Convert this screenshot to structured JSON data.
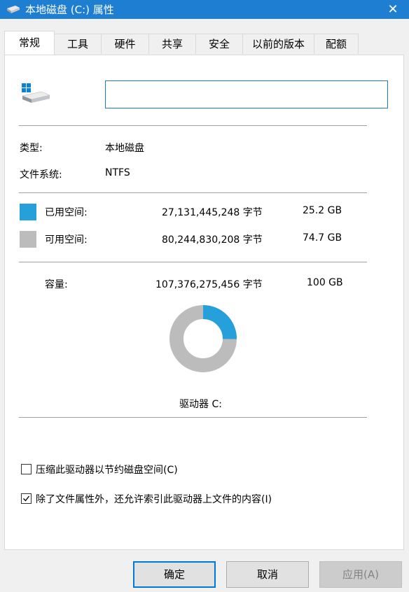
{
  "window": {
    "title": "本地磁盘 (C:) 属性",
    "close": "✕"
  },
  "tabs": [
    "常规",
    "工具",
    "硬件",
    "共享",
    "安全",
    "以前的版本",
    "配额"
  ],
  "active_tab": "常规",
  "drive": {
    "name_value": ""
  },
  "info": {
    "type_label": "类型:",
    "type_value": "本地磁盘",
    "fs_label": "文件系统:",
    "fs_value": "NTFS"
  },
  "space": {
    "used": {
      "label": "已用空间:",
      "bytes": "27,131,445,248 字节",
      "size": "25.2 GB",
      "color": "#26a0da"
    },
    "free": {
      "label": "可用空间:",
      "bytes": "80,244,830,208 字节",
      "size": "74.7 GB",
      "color": "#bcbcbc"
    },
    "capacity": {
      "label": "容量:",
      "bytes": "107,376,275,456 字节",
      "size": "100 GB"
    },
    "used_fraction": 0.252
  },
  "drive_label": "驱动器 C:",
  "options": {
    "compress": {
      "label": "压缩此驱动器以节约磁盘空间(C)",
      "checked": false
    },
    "index": {
      "label": "除了文件属性外，还允许索引此驱动器上文件的内容(I)",
      "checked": true
    }
  },
  "buttons": {
    "ok": "确定",
    "cancel": "取消",
    "apply": "应用(A)"
  }
}
